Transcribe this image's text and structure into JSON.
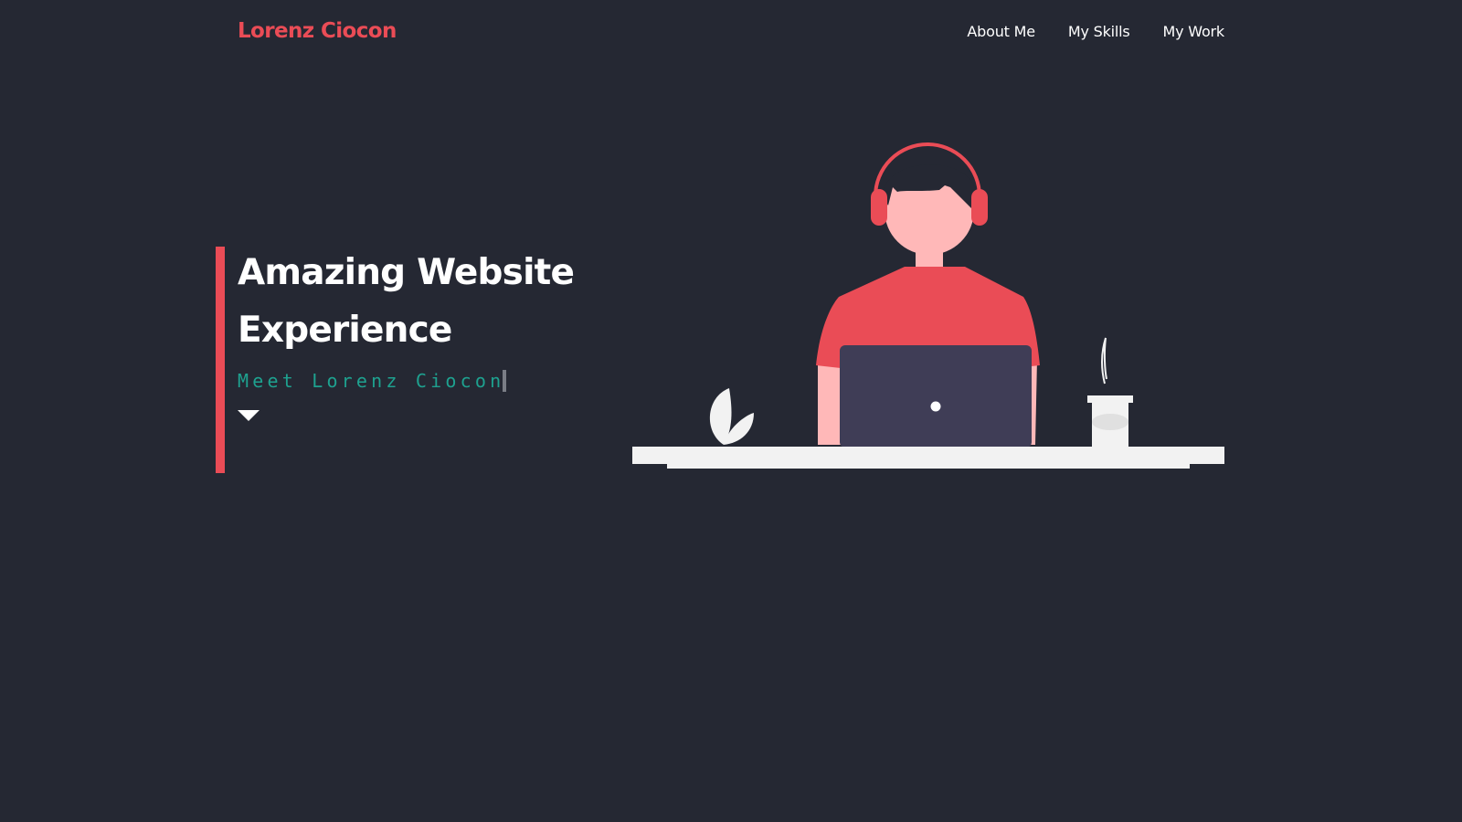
{
  "header": {
    "logo": "Lorenz Ciocon",
    "nav": [
      {
        "label": "About Me"
      },
      {
        "label": "My Skills"
      },
      {
        "label": "My Work"
      }
    ]
  },
  "hero": {
    "title_line1": "Amazing Website",
    "title_line2": "Experience",
    "subtitle": "Meet Lorenz Ciocon"
  },
  "colors": {
    "background": "#252833",
    "accent": "#ea4c56",
    "subtitle": "#1ea18f",
    "laptop": "#3f3d56",
    "desk": "#f2f2f2",
    "skin": "#ffb8b8"
  },
  "icons": {
    "scroll_indicator": "triangle-down-icon",
    "text_cursor": "caret-icon"
  }
}
